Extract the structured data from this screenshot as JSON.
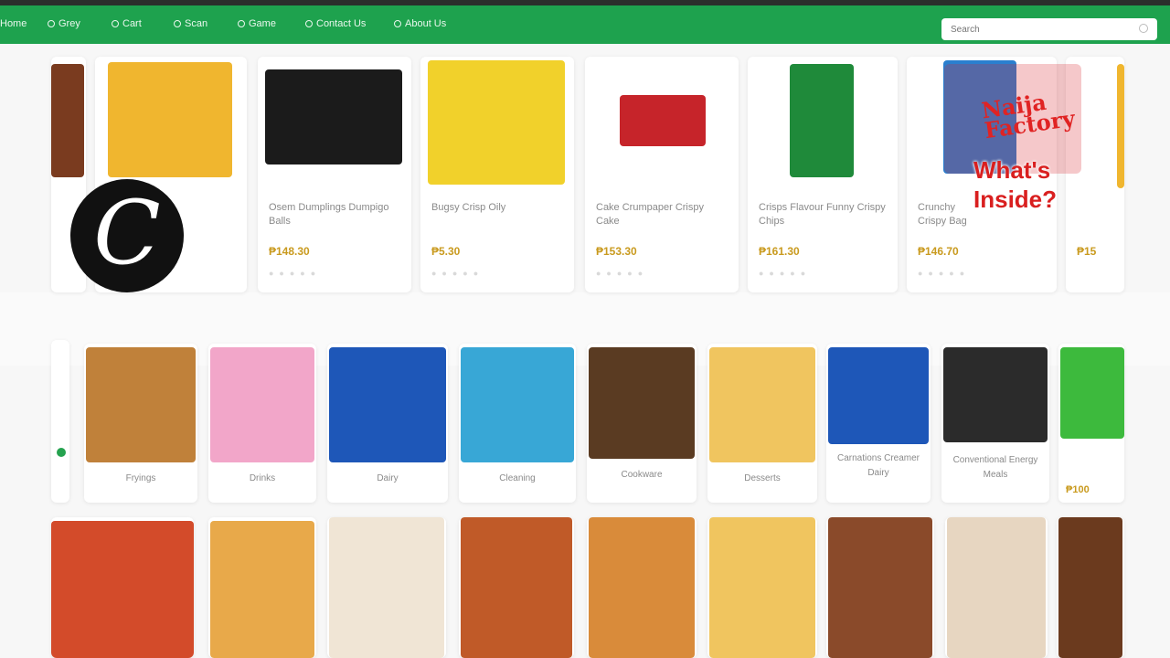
{
  "nav": {
    "items": [
      {
        "label": "Home",
        "icon": "home-icon"
      },
      {
        "label": "Grey",
        "icon": "circle-icon"
      },
      {
        "label": "Cart",
        "icon": "cart-icon"
      },
      {
        "label": "Scan",
        "icon": "scan-icon"
      },
      {
        "label": "Game",
        "icon": "phone-icon"
      },
      {
        "label": "Contact Us",
        "icon": "contact-icon"
      },
      {
        "label": "About Us",
        "icon": "info-icon"
      }
    ],
    "search_placeholder": "Search"
  },
  "products": [
    {
      "name": "",
      "price": ""
    },
    {
      "name": "",
      "price": ""
    },
    {
      "name": "Osem Dumplings Dumpigo Balls",
      "price": "₱148.30"
    },
    {
      "name": "Bugsy Crisp Oily",
      "price": "₱5.30"
    },
    {
      "name": "Cake Crumpaper Crispy Cake",
      "price": "₱153.30"
    },
    {
      "name": "Crisps Flavour Funny Crispy Chips",
      "price": "₱161.30"
    },
    {
      "name": "Crunchy Crispy Bag",
      "price": "₱146.70"
    },
    {
      "name": "",
      "price": "₱15"
    }
  ],
  "categories": [
    {
      "label": "",
      "color": "#ffffff"
    },
    {
      "label": "Fryings",
      "color": "#c0813a"
    },
    {
      "label": "Drinks",
      "color": "#f2a6c9"
    },
    {
      "label": "Dairy",
      "color": "#1e57b8"
    },
    {
      "label": "Cleaning",
      "color": "#38a7d6"
    },
    {
      "label": "Cookware",
      "color": "#5a3b22"
    },
    {
      "label": "Desserts",
      "color": "#f0c55f"
    },
    {
      "label": "Carnations Creamer Dairy",
      "color": "#1e57b8"
    },
    {
      "label": "Conventional Energy Meals",
      "color": "#2b2b2b"
    },
    {
      "label": "₱100",
      "color": "#3dba3d"
    }
  ],
  "grid_colors": [
    "#ffffff",
    "#d34b2a",
    "#f0e5d5",
    "#c05a28",
    "#e8a94a",
    "#d98b3a",
    "#f0c55f",
    "#8a4a2a",
    "#e7d6c1",
    "#6b3a1e"
  ],
  "overlay": {
    "title": "Naija Factory",
    "subtitle_line1": "What's",
    "subtitle_line2": "Inside?"
  },
  "logo_letter": "C"
}
